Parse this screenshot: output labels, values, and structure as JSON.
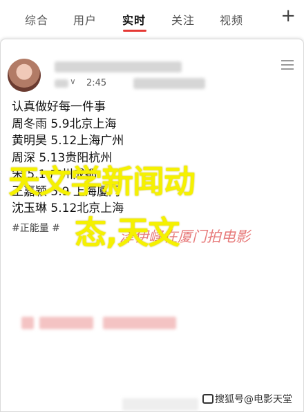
{
  "tabs": [
    {
      "label": "综合"
    },
    {
      "label": "用户"
    },
    {
      "label": "实时"
    },
    {
      "label": "关注"
    },
    {
      "label": "视频"
    }
  ],
  "tab_plus": "+",
  "post": {
    "time": "2:45",
    "lines": [
      "认真做好每一件事",
      "周冬雨 5.9北京上海",
      "黄明昊 5.12上海广州",
      "周深 5.13贵阳杭州",
      "宋 5.1 广州成都",
      "王嘉颖 5.9 上海厦门",
      "沈玉琳 5.12北京上海"
    ],
    "tag": "#正能量 #"
  },
  "overlay": {
    "title_line1": "天文学新闻动",
    "title_line2": "态,天文",
    "red_text": "泽伊峰在厦门拍电影"
  },
  "watermark": "搜狐号@电影天堂",
  "colors": {
    "accent": "#e53935",
    "overlay_yellow": "#f5f100"
  }
}
